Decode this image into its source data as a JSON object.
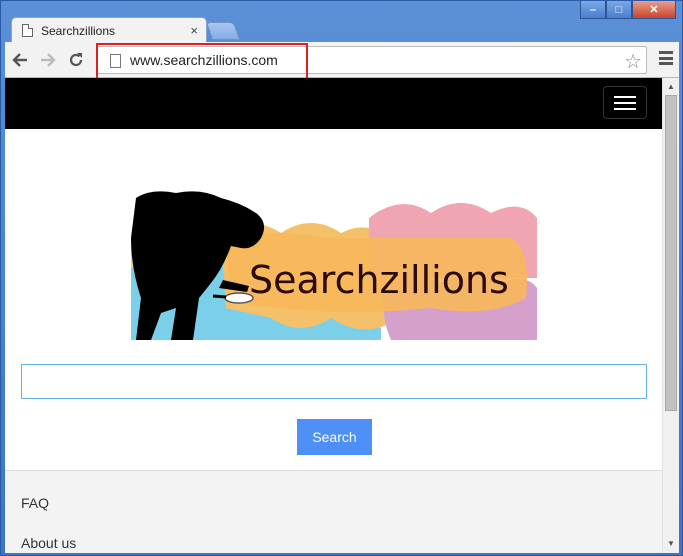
{
  "browser": {
    "tab_title": "Searchzillions",
    "tab_close": "×",
    "url": "www.searchzillions.com",
    "controls": {
      "minimize": "–",
      "maximize": "□",
      "close": "✕"
    }
  },
  "site": {
    "logo_text": "Searchzillions",
    "search": {
      "value": "",
      "button_label": "Search"
    },
    "footer_links": [
      "FAQ",
      "About us"
    ]
  },
  "colors": {
    "nav_bg": "#000000",
    "button_bg": "#4d8ff4",
    "highlight": "#e02020"
  }
}
